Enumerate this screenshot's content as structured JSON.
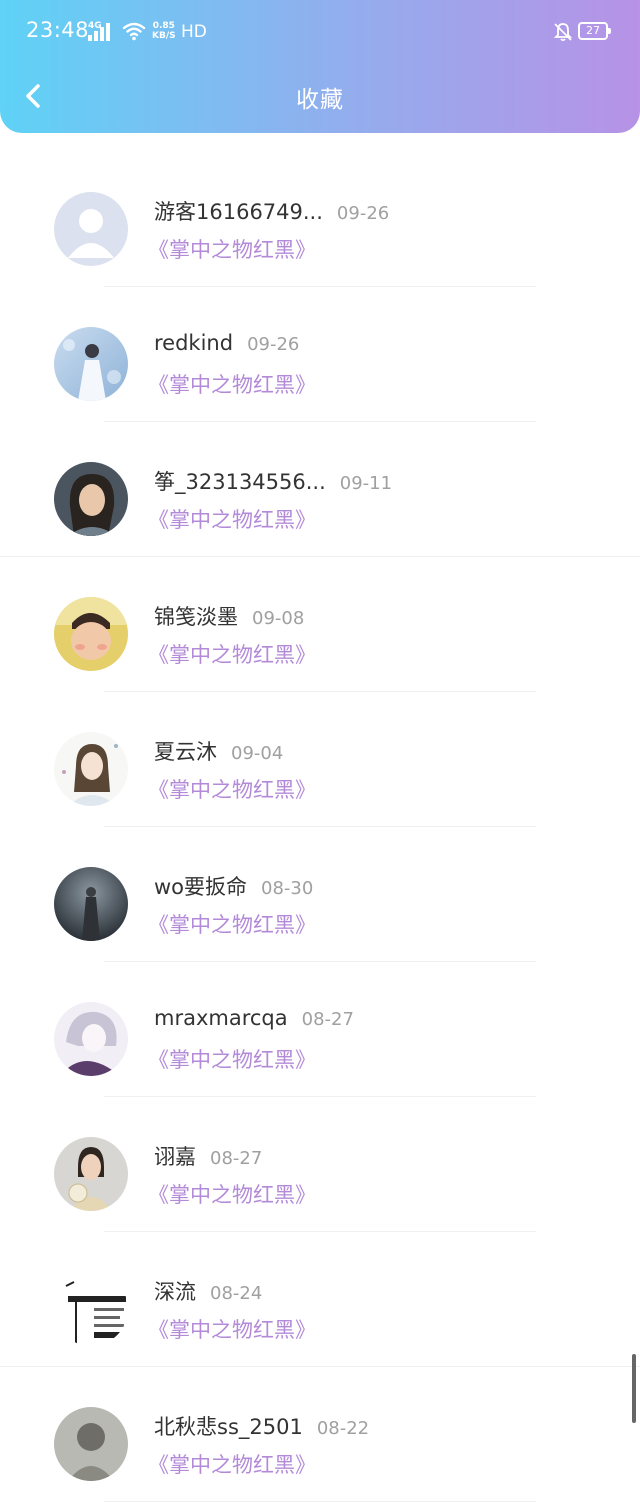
{
  "status_bar": {
    "time": "23:48",
    "signal": "4G",
    "speed_top": "0.85",
    "speed_bottom": "KB/S",
    "hd": "HD",
    "battery": "27"
  },
  "header": {
    "title": "收藏",
    "gradient": [
      "#5fd2f6",
      "#b792e6"
    ]
  },
  "colors": {
    "name": "#333333",
    "date": "#a0a0a0",
    "book": "#b38ad8"
  },
  "items": [
    {
      "name": "游客16166749...",
      "date": "09-26",
      "book": "《掌中之物红黑》",
      "avatar": "default-avatar-icon"
    },
    {
      "name": "redkind",
      "date": "09-26",
      "book": "《掌中之物红黑》",
      "avatar": "avatar"
    },
    {
      "name": "筝_323134556...",
      "date": "09-11",
      "book": "《掌中之物红黑》",
      "avatar": "avatar"
    },
    {
      "name": "锦笺淡墨",
      "date": "09-08",
      "book": "《掌中之物红黑》",
      "avatar": "avatar"
    },
    {
      "name": "夏云沐",
      "date": "09-04",
      "book": "《掌中之物红黑》",
      "avatar": "avatar"
    },
    {
      "name": "wo要扳命",
      "date": "08-30",
      "book": "《掌中之物红黑》",
      "avatar": "avatar"
    },
    {
      "name": "mraxmarcqa",
      "date": "08-27",
      "book": "《掌中之物红黑》",
      "avatar": "avatar"
    },
    {
      "name": "诩嘉",
      "date": "08-27",
      "book": "《掌中之物红黑》",
      "avatar": "avatar"
    },
    {
      "name": "深流",
      "date": "08-24",
      "book": "《掌中之物红黑》",
      "avatar": "avatar"
    },
    {
      "name": "北秋悲ss_2501",
      "date": "08-22",
      "book": "《掌中之物红黑》",
      "avatar": "avatar"
    }
  ]
}
